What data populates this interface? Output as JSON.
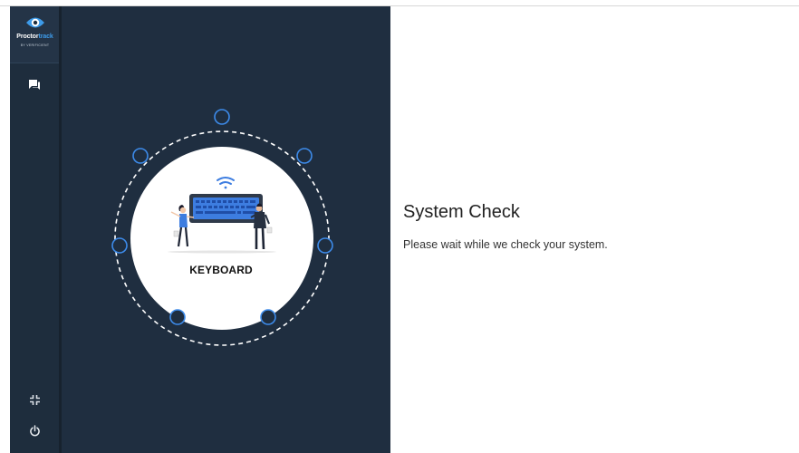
{
  "brand": {
    "name_part1": "Proctor",
    "name_part2": "track",
    "byline": "BY VERIFICIENT",
    "accent_color": "#3d9be9"
  },
  "sidebar": {
    "items": [
      {
        "icon": "chat-icon"
      },
      {
        "icon": "minimize-icon"
      },
      {
        "icon": "power-icon"
      }
    ]
  },
  "illustration": {
    "device_label": "KEYBOARD",
    "device_icon": "keyboard-icon",
    "status_icon": "wifi-icon"
  },
  "main": {
    "title": "System Check",
    "message": "Please wait while we check your system."
  }
}
